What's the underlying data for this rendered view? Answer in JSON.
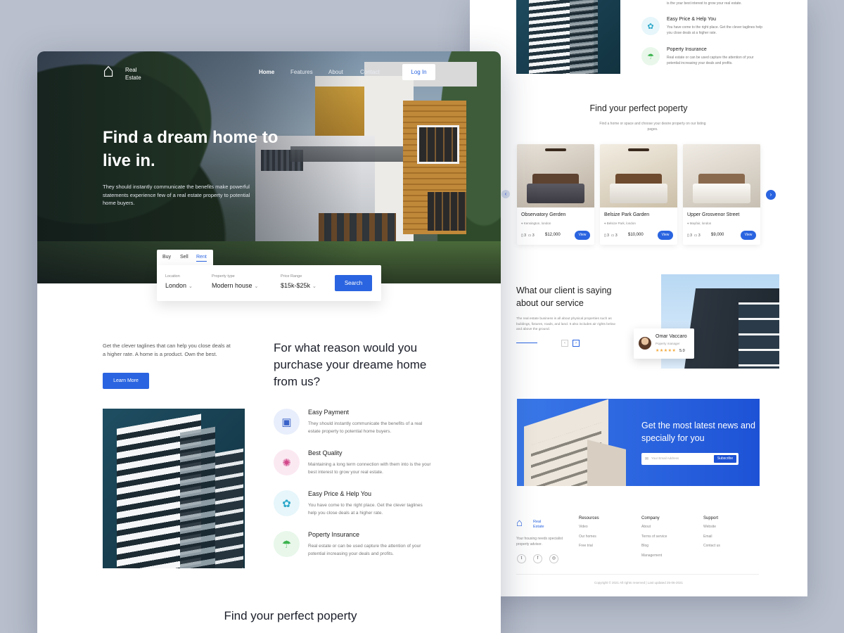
{
  "brand": {
    "name_line1": "Real",
    "name_line2": "Estate",
    "logo_icon": "house-icon"
  },
  "nav": {
    "items": [
      "Home",
      "Features",
      "About",
      "Contact"
    ],
    "active": "Home",
    "login_label": "Log In"
  },
  "hero": {
    "title": "Find a dream home to live in.",
    "description": "They should instantly communicate the benefits make powerful statements experience few of a real estate property to potential home buyers."
  },
  "search": {
    "tabs": [
      "Buy",
      "Sell",
      "Rent"
    ],
    "active_tab": "Rent",
    "fields": [
      {
        "label": "Location",
        "value": "London"
      },
      {
        "label": "Property type",
        "value": "Modern house"
      },
      {
        "label": "Price Range",
        "value": "$15k-$25k"
      }
    ],
    "button_label": "Search"
  },
  "why": {
    "description": "Get the clever taglines that can help you close deals at a higher rate. A home is a product. Own the best.",
    "button_label": "Learn More",
    "title": "For what reason would you purchase your dreame home from us?",
    "features": [
      {
        "title": "Easy Payment",
        "description": "They should instantly communicate the benefits of a real estate property to potential home buyers.",
        "icon": "phone-payment-icon",
        "color": "#e8eefb"
      },
      {
        "title": "Best Quality",
        "description": "Maintaining a long term connection with them into is the your best interest to grow your real estate.",
        "icon": "badge-icon",
        "color": "#fbe9f2"
      },
      {
        "title": "Easy Price & Help You",
        "description": "You have come to the right place. Get the clever taglines help you close deals at a higher rate.",
        "icon": "gear-help-icon",
        "color": "#e6f6fb"
      },
      {
        "title": "Poperty Insurance",
        "description": "Real estate or can be used capture the attention of your potential increasing your deals and profits.",
        "icon": "insurance-icon",
        "color": "#e8f7ea"
      }
    ]
  },
  "find_section": {
    "title": "Find your perfect poperty"
  },
  "back_page": {
    "top_snippet": "is the your best interest to grow your real estate.",
    "mini_features": [
      {
        "title": "Easy Price & Help You",
        "description": "You have come to the right place. Get the clever taglines help you close deals at a higher rate.",
        "icon": "gear-help-icon",
        "color": "#e6f6fb"
      },
      {
        "title": "Poperty Insurance",
        "description": "Real estate or can be used capture the attention of your potential increasing your deals and profits.",
        "icon": "insurance-icon",
        "color": "#e8f7ea"
      }
    ],
    "find_title": "Find your perfect poperty",
    "find_subtitle": "Find a home or space and choose your desire property on our listing pages.",
    "properties": [
      {
        "name": "Observatory Gerden",
        "location": "Kensington, london",
        "beds": "3",
        "baths": "3",
        "price": "$12,000",
        "view_label": "View"
      },
      {
        "name": "Belsize Park Garden",
        "location": "Belsize Park, london",
        "beds": "3",
        "baths": "3",
        "price": "$10,000",
        "view_label": "View"
      },
      {
        "name": "Upper Grosvenor Street",
        "location": "Mayfair, london",
        "beds": "3",
        "baths": "3",
        "price": "$9,000",
        "view_label": "View"
      }
    ],
    "testimonial": {
      "title": "What our client is saying about our service",
      "description": "The real estate business is all about physical properties such as buildings, fixtures, roads, and land. It also includes air rights below and above the ground.",
      "name": "Omar Vaccaro",
      "role": "Poperty manager",
      "stars": "★★★★★",
      "score": "5.0"
    },
    "newsletter": {
      "title": "Get the most latest news and specially for you",
      "placeholder": "Your Email Address",
      "button_label": "Subscribe"
    },
    "footer": {
      "tagline": "Your housing needs specialist property advisor.",
      "columns": [
        {
          "heading": "Resources",
          "links": [
            "Video",
            "Our homes",
            "Free trial"
          ]
        },
        {
          "heading": "Company",
          "links": [
            "About",
            "Terms of service",
            "Blog",
            "Management"
          ]
        },
        {
          "heading": "Support",
          "links": [
            "Website",
            "Email",
            "Contact us"
          ]
        }
      ],
      "social_icons": [
        "twitter-icon",
        "facebook-icon",
        "instagram-icon"
      ],
      "copyright": "Copyright © 2021 All rights reserved | Last updated 25-06-2021"
    }
  },
  "colors": {
    "accent": "#2a64e0",
    "background": "#b9bfcc"
  }
}
